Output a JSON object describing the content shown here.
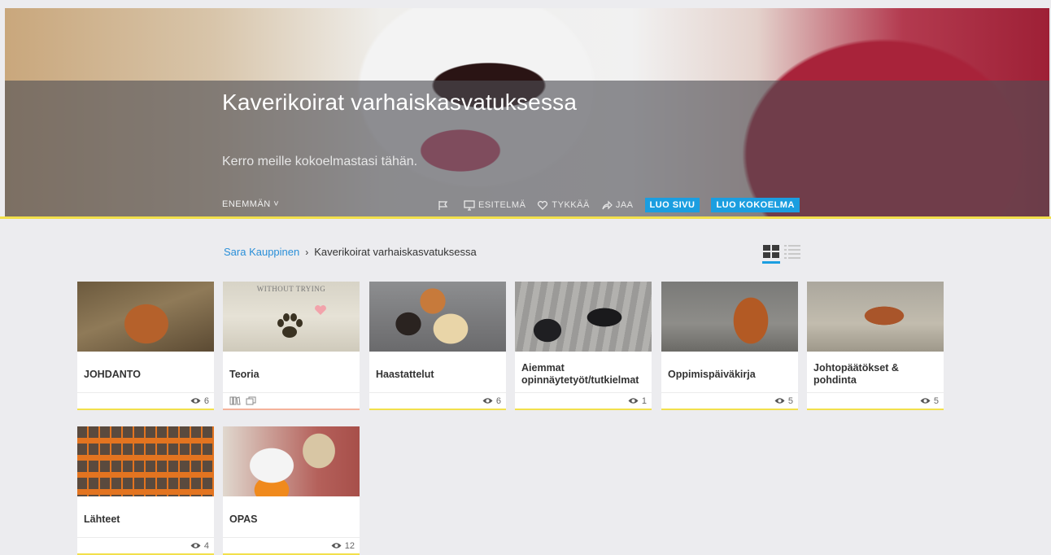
{
  "hero": {
    "title": "Kaverikoirat varhaiskasvatuksessa",
    "description": "Kerro meille kokoelmastasi tähän.",
    "more_label": "ENEMMÄN",
    "presentation_label": "ESITELMÄ",
    "like_label": "TYKKÄÄ",
    "share_label": "JAA",
    "create_page_label": "LUO SIVU",
    "create_collection_label": "LUO KOKOELMA"
  },
  "breadcrumb": {
    "owner": "Sara Kauppinen",
    "current": "Kaverikoirat varhaiskasvatuksessa"
  },
  "colors": {
    "accent": "#1b9ee0",
    "underline": "#f2e04b"
  },
  "cards": [
    {
      "title": "JOHDANTO",
      "views": "6"
    },
    {
      "title": "Teoria",
      "views": "",
      "thumb_text": "WITHOUT TRYING"
    },
    {
      "title": "Haastattelut",
      "views": "6"
    },
    {
      "title": "Aiemmat opinnäytetyöt/tutkielmat",
      "views": "1"
    },
    {
      "title": "Oppimispäiväkirja",
      "views": "5"
    },
    {
      "title": "Johtopäätökset & pohdinta",
      "views": "5"
    },
    {
      "title": "Lähteet",
      "views": "4"
    },
    {
      "title": "OPAS",
      "views": "12"
    }
  ]
}
